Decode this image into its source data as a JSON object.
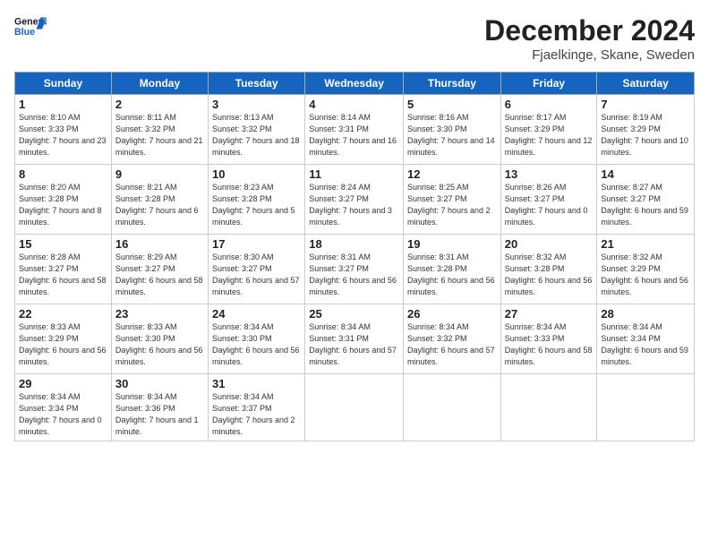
{
  "header": {
    "logo_line1": "General",
    "logo_line2": "Blue",
    "month_title": "December 2024",
    "location": "Fjaelkinge, Skane, Sweden"
  },
  "weekdays": [
    "Sunday",
    "Monday",
    "Tuesday",
    "Wednesday",
    "Thursday",
    "Friday",
    "Saturday"
  ],
  "weeks": [
    [
      {
        "day": "1",
        "sunrise": "Sunrise: 8:10 AM",
        "sunset": "Sunset: 3:33 PM",
        "daylight": "Daylight: 7 hours and 23 minutes."
      },
      {
        "day": "2",
        "sunrise": "Sunrise: 8:11 AM",
        "sunset": "Sunset: 3:32 PM",
        "daylight": "Daylight: 7 hours and 21 minutes."
      },
      {
        "day": "3",
        "sunrise": "Sunrise: 8:13 AM",
        "sunset": "Sunset: 3:32 PM",
        "daylight": "Daylight: 7 hours and 18 minutes."
      },
      {
        "day": "4",
        "sunrise": "Sunrise: 8:14 AM",
        "sunset": "Sunset: 3:31 PM",
        "daylight": "Daylight: 7 hours and 16 minutes."
      },
      {
        "day": "5",
        "sunrise": "Sunrise: 8:16 AM",
        "sunset": "Sunset: 3:30 PM",
        "daylight": "Daylight: 7 hours and 14 minutes."
      },
      {
        "day": "6",
        "sunrise": "Sunrise: 8:17 AM",
        "sunset": "Sunset: 3:29 PM",
        "daylight": "Daylight: 7 hours and 12 minutes."
      },
      {
        "day": "7",
        "sunrise": "Sunrise: 8:19 AM",
        "sunset": "Sunset: 3:29 PM",
        "daylight": "Daylight: 7 hours and 10 minutes."
      }
    ],
    [
      {
        "day": "8",
        "sunrise": "Sunrise: 8:20 AM",
        "sunset": "Sunset: 3:28 PM",
        "daylight": "Daylight: 7 hours and 8 minutes."
      },
      {
        "day": "9",
        "sunrise": "Sunrise: 8:21 AM",
        "sunset": "Sunset: 3:28 PM",
        "daylight": "Daylight: 7 hours and 6 minutes."
      },
      {
        "day": "10",
        "sunrise": "Sunrise: 8:23 AM",
        "sunset": "Sunset: 3:28 PM",
        "daylight": "Daylight: 7 hours and 5 minutes."
      },
      {
        "day": "11",
        "sunrise": "Sunrise: 8:24 AM",
        "sunset": "Sunset: 3:27 PM",
        "daylight": "Daylight: 7 hours and 3 minutes."
      },
      {
        "day": "12",
        "sunrise": "Sunrise: 8:25 AM",
        "sunset": "Sunset: 3:27 PM",
        "daylight": "Daylight: 7 hours and 2 minutes."
      },
      {
        "day": "13",
        "sunrise": "Sunrise: 8:26 AM",
        "sunset": "Sunset: 3:27 PM",
        "daylight": "Daylight: 7 hours and 0 minutes."
      },
      {
        "day": "14",
        "sunrise": "Sunrise: 8:27 AM",
        "sunset": "Sunset: 3:27 PM",
        "daylight": "Daylight: 6 hours and 59 minutes."
      }
    ],
    [
      {
        "day": "15",
        "sunrise": "Sunrise: 8:28 AM",
        "sunset": "Sunset: 3:27 PM",
        "daylight": "Daylight: 6 hours and 58 minutes."
      },
      {
        "day": "16",
        "sunrise": "Sunrise: 8:29 AM",
        "sunset": "Sunset: 3:27 PM",
        "daylight": "Daylight: 6 hours and 58 minutes."
      },
      {
        "day": "17",
        "sunrise": "Sunrise: 8:30 AM",
        "sunset": "Sunset: 3:27 PM",
        "daylight": "Daylight: 6 hours and 57 minutes."
      },
      {
        "day": "18",
        "sunrise": "Sunrise: 8:31 AM",
        "sunset": "Sunset: 3:27 PM",
        "daylight": "Daylight: 6 hours and 56 minutes."
      },
      {
        "day": "19",
        "sunrise": "Sunrise: 8:31 AM",
        "sunset": "Sunset: 3:28 PM",
        "daylight": "Daylight: 6 hours and 56 minutes."
      },
      {
        "day": "20",
        "sunrise": "Sunrise: 8:32 AM",
        "sunset": "Sunset: 3:28 PM",
        "daylight": "Daylight: 6 hours and 56 minutes."
      },
      {
        "day": "21",
        "sunrise": "Sunrise: 8:32 AM",
        "sunset": "Sunset: 3:29 PM",
        "daylight": "Daylight: 6 hours and 56 minutes."
      }
    ],
    [
      {
        "day": "22",
        "sunrise": "Sunrise: 8:33 AM",
        "sunset": "Sunset: 3:29 PM",
        "daylight": "Daylight: 6 hours and 56 minutes."
      },
      {
        "day": "23",
        "sunrise": "Sunrise: 8:33 AM",
        "sunset": "Sunset: 3:30 PM",
        "daylight": "Daylight: 6 hours and 56 minutes."
      },
      {
        "day": "24",
        "sunrise": "Sunrise: 8:34 AM",
        "sunset": "Sunset: 3:30 PM",
        "daylight": "Daylight: 6 hours and 56 minutes."
      },
      {
        "day": "25",
        "sunrise": "Sunrise: 8:34 AM",
        "sunset": "Sunset: 3:31 PM",
        "daylight": "Daylight: 6 hours and 57 minutes."
      },
      {
        "day": "26",
        "sunrise": "Sunrise: 8:34 AM",
        "sunset": "Sunset: 3:32 PM",
        "daylight": "Daylight: 6 hours and 57 minutes."
      },
      {
        "day": "27",
        "sunrise": "Sunrise: 8:34 AM",
        "sunset": "Sunset: 3:33 PM",
        "daylight": "Daylight: 6 hours and 58 minutes."
      },
      {
        "day": "28",
        "sunrise": "Sunrise: 8:34 AM",
        "sunset": "Sunset: 3:34 PM",
        "daylight": "Daylight: 6 hours and 59 minutes."
      }
    ],
    [
      {
        "day": "29",
        "sunrise": "Sunrise: 8:34 AM",
        "sunset": "Sunset: 3:34 PM",
        "daylight": "Daylight: 7 hours and 0 minutes."
      },
      {
        "day": "30",
        "sunrise": "Sunrise: 8:34 AM",
        "sunset": "Sunset: 3:36 PM",
        "daylight": "Daylight: 7 hours and 1 minute."
      },
      {
        "day": "31",
        "sunrise": "Sunrise: 8:34 AM",
        "sunset": "Sunset: 3:37 PM",
        "daylight": "Daylight: 7 hours and 2 minutes."
      },
      null,
      null,
      null,
      null
    ]
  ]
}
